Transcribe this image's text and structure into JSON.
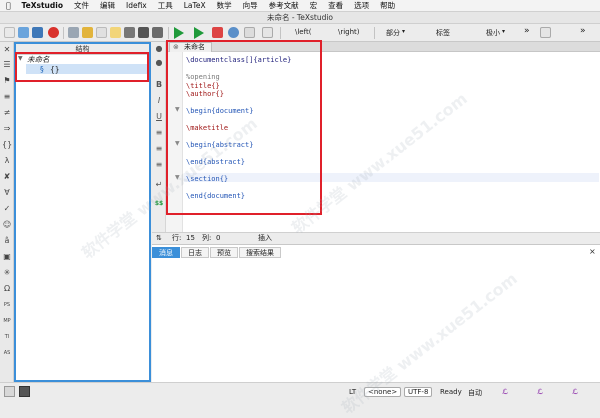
{
  "menubar": {
    "items": [
      "TeXstudio",
      "文件",
      "编辑",
      "Idefix",
      "工具",
      "LaTeX",
      "数学",
      "向导",
      "参考文献",
      "宏",
      "查看",
      "选项",
      "帮助"
    ]
  },
  "window": {
    "title": "未命名 - TeXstudio"
  },
  "toolbar": {
    "left_paren": "\\left(",
    "right_paren": "\\right)",
    "section": "部分",
    "label": "标签",
    "size": "极小",
    "more": "»"
  },
  "structure": {
    "title": "结构",
    "root": "未命名",
    "child": "{}"
  },
  "editor": {
    "tab": "未命名",
    "lines": [
      [
        "\\documentclass[]{article}"
      ],
      [
        ""
      ],
      [
        "%opening"
      ],
      [
        "\\title{}"
      ],
      [
        "\\author{}"
      ],
      [
        ""
      ],
      [
        "\\begin{document}"
      ],
      [
        ""
      ],
      [
        "\\maketitle"
      ],
      [
        ""
      ],
      [
        "\\begin{abstract}"
      ],
      [
        ""
      ],
      [
        "\\end{abstract}"
      ],
      [
        ""
      ],
      [
        "\\section{}"
      ],
      [
        ""
      ],
      [
        "\\end{document}"
      ]
    ],
    "code": {
      "l1_cmd": "\\documentclass[]{article}",
      "l3": "%opening",
      "l4": "\\title{}",
      "l5": "\\author{}",
      "l7": "\\begin{document}",
      "l9": "\\maketitle",
      "l11": "\\begin{abstract}",
      "l13": "\\end{abstract}",
      "l15": "\\section{}",
      "l17": "\\end{document}"
    }
  },
  "status": {
    "row_label": "行:",
    "row": "15",
    "col_label": "列:",
    "col": "0",
    "mode": "插入"
  },
  "messages": {
    "tabs": [
      "消息",
      "日志",
      "预览",
      "搜索结果"
    ],
    "close": "×"
  },
  "bottombar": {
    "lt": "LT",
    "encoding_none": "<none>",
    "encoding": "UTF-8",
    "ready": "Ready",
    "auto": "自动"
  },
  "watermark": "软件学堂 www.xue51.com",
  "colors": {
    "selection_blue": "#3b8fd9",
    "highlight_red": "#e0202a"
  }
}
